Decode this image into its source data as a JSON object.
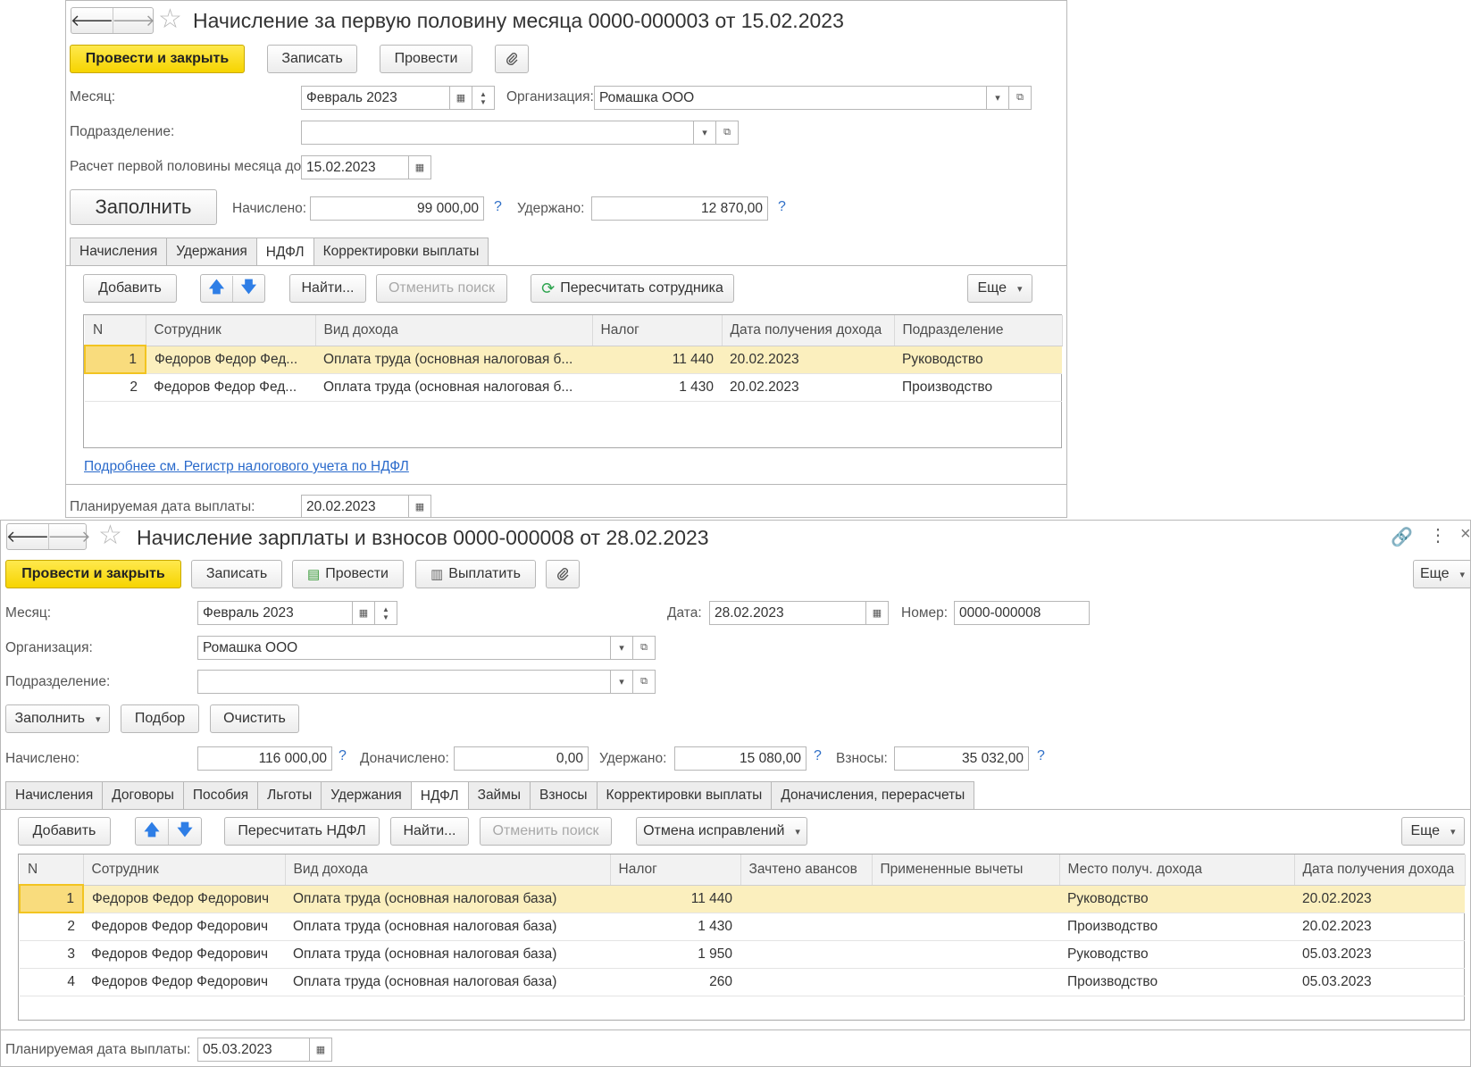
{
  "doc1": {
    "nav": {
      "back": "🡐",
      "forward": "🡒"
    },
    "star": "☆",
    "title": "Начисление за первую половину месяца 0000-000003 от 15.02.2023",
    "toolbar": {
      "post_close": "Провести и закрыть",
      "save": "Записать",
      "post": "Провести"
    },
    "fields": {
      "month_label": "Месяц:",
      "month_value": "Февраль 2023",
      "org_label": "Организация:",
      "org_value": "Ромашка ООО",
      "dept_label": "Подразделение:",
      "dept_value": "",
      "calc_label": "Расчет первой половины месяца до:",
      "calc_value": "15.02.2023",
      "accrued_label": "Начислено:",
      "accrued_value": "99 000,00",
      "withheld_label": "Удержано:",
      "withheld_value": "12 870,00",
      "payday_label": "Планируемая дата выплаты:",
      "payday_value": "20.02.2023"
    },
    "fill_button": "Заполнить",
    "tabs": [
      "Начисления",
      "Удержания",
      "НДФЛ",
      "Корректировки выплаты"
    ],
    "active_tab": "НДФЛ",
    "table_toolbar": {
      "add": "Добавить",
      "find": "Найти...",
      "cancel_search": "Отменить поиск",
      "recalc": "Пересчитать сотрудника",
      "more": "Еще"
    },
    "table": {
      "columns": [
        "N",
        "Сотрудник",
        "Вид дохода",
        "Налог",
        "Дата получения дохода",
        "Подразделение"
      ],
      "rows": [
        {
          "n": "1",
          "employee": "Федоров Федор Фед...",
          "income": "Оплата труда (основная налоговая б...",
          "tax": "11 440",
          "date": "20.02.2023",
          "dept": "Руководство"
        },
        {
          "n": "2",
          "employee": "Федоров Федор Фед...",
          "income": "Оплата труда (основная налоговая б...",
          "tax": "1 430",
          "date": "20.02.2023",
          "dept": "Производство"
        }
      ]
    },
    "register_link": "Подробнее см. Регистр налогового учета по НДФЛ"
  },
  "doc2": {
    "title": "Начисление зарплаты и взносов 0000-000008 от 28.02.2023",
    "toolbar": {
      "post_close": "Провести и закрыть",
      "save": "Записать",
      "post": "Провести",
      "pay": "Выплатить",
      "more": "Еще"
    },
    "fields": {
      "month_label": "Месяц:",
      "month_value": "Февраль 2023",
      "date_label": "Дата:",
      "date_value": "28.02.2023",
      "number_label": "Номер:",
      "number_value": "0000-000008",
      "org_label": "Организация:",
      "org_value": "Ромашка ООО",
      "dept_label": "Подразделение:",
      "dept_value": "",
      "accrued_label": "Начислено:",
      "accrued_value": "116 000,00",
      "extra_label": "Доначислено:",
      "extra_value": "0,00",
      "withheld_label": "Удержано:",
      "withheld_value": "15 080,00",
      "contrib_label": "Взносы:",
      "contrib_value": "35 032,00",
      "payday_label": "Планируемая дата выплаты:",
      "payday_value": "05.03.2023"
    },
    "action_buttons": {
      "fill": "Заполнить",
      "select": "Подбор",
      "clear": "Очистить"
    },
    "tabs": [
      "Начисления",
      "Договоры",
      "Пособия",
      "Льготы",
      "Удержания",
      "НДФЛ",
      "Займы",
      "Взносы",
      "Корректировки выплаты",
      "Доначисления, перерасчеты"
    ],
    "active_tab": "НДФЛ",
    "table_toolbar": {
      "add": "Добавить",
      "recalc": "Пересчитать НДФЛ",
      "find": "Найти...",
      "cancel_search": "Отменить поиск",
      "undo_fix": "Отмена исправлений",
      "more": "Еще"
    },
    "table": {
      "columns": [
        "N",
        "Сотрудник",
        "Вид дохода",
        "Налог",
        "Зачтено авансов",
        "Примененные вычеты",
        "Место получ. дохода",
        "Дата получения дохода"
      ],
      "rows": [
        {
          "n": "1",
          "employee": "Федоров Федор Федорович",
          "income": "Оплата труда (основная налоговая база)",
          "tax": "11 440",
          "advance": "",
          "deductions": "",
          "place": "Руководство",
          "date": "20.02.2023"
        },
        {
          "n": "2",
          "employee": "Федоров Федор Федорович",
          "income": "Оплата труда (основная налоговая база)",
          "tax": "1 430",
          "advance": "",
          "deductions": "",
          "place": "Производство",
          "date": "20.02.2023"
        },
        {
          "n": "3",
          "employee": "Федоров Федор Федорович",
          "income": "Оплата труда (основная налоговая база)",
          "tax": "1 950",
          "advance": "",
          "deductions": "",
          "place": "Руководство",
          "date": "05.03.2023"
        },
        {
          "n": "4",
          "employee": "Федоров Федор Федорович",
          "income": "Оплата труда (основная налоговая база)",
          "tax": "260",
          "advance": "",
          "deductions": "",
          "place": "Производство",
          "date": "05.03.2023"
        }
      ]
    }
  }
}
